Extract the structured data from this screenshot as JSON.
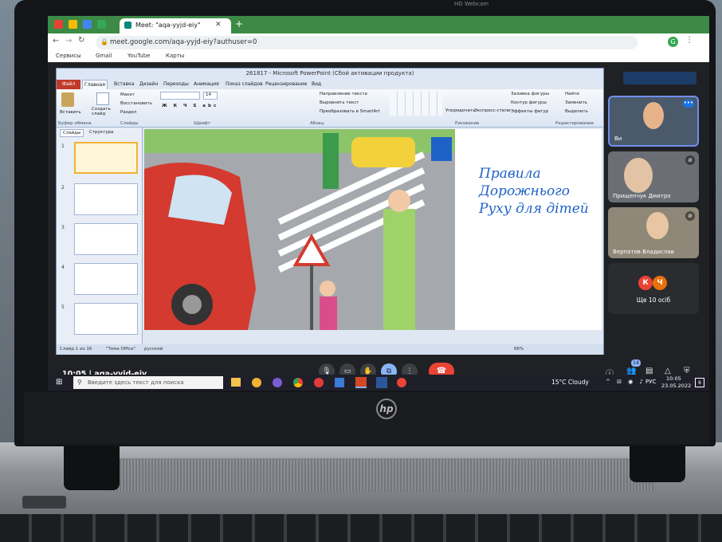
{
  "browser": {
    "tab_title": "Meet: \"aqa-yyjd-eiy\"",
    "close_glyph": "✕",
    "new_tab_glyph": "+",
    "url": "meet.google.com/aqa-yyjd-eiy?authuser=0",
    "bookmarks": [
      "Сервисы",
      "Gmail",
      "YouTube",
      "Карты"
    ],
    "profile_letter": "G"
  },
  "ppt": {
    "window_title": "261817 - Microsoft PowerPoint (Сбой активации продукта)",
    "file_tab": "Файл",
    "tabs": [
      "Главная",
      "Вставка",
      "Дизайн",
      "Переходы",
      "Анимация",
      "Показ слайдов",
      "Рецензирование",
      "Вид"
    ],
    "ribbon": {
      "paste": "Вставить",
      "create_slide": "Создать слайд",
      "layout": "Макет",
      "restore": "Восстановить",
      "section": "Раздел",
      "font_size": "14",
      "text_direction": "Направление текста",
      "align_text": "Выровнять текст",
      "smartart": "Преобразовать в SmartArt",
      "arrange": "Упорядочить",
      "quick_styles": "Экспресс-стили",
      "shape_fill": "Заливка фигуры",
      "shape_outline": "Контур фигуры",
      "shape_effects": "Эффекты фигур",
      "find": "Найти",
      "replace": "Заменить",
      "select": "Выделить",
      "groups": [
        "Буфер обмена",
        "Слайды",
        "Шрифт",
        "Абзац",
        "Рисование",
        "Редактирование"
      ]
    },
    "panel_tabs": [
      "Слайды",
      "Структура"
    ],
    "thumb_numbers": [
      "1",
      "2",
      "3",
      "4",
      "5"
    ],
    "slide_title": "Правила Дорожнього Руху для дітей",
    "status": {
      "slide_of": "Слайд 1 из 16",
      "theme": "\"Тема Office\"",
      "language": "русский",
      "zoom": "66%"
    }
  },
  "participants": [
    {
      "name": "Ви",
      "muted": false
    },
    {
      "name": "Прищепчук Дмитро",
      "muted": true
    },
    {
      "name": "Верпатов Владислав",
      "muted": true
    }
  ],
  "more_people": {
    "avatars": [
      "К",
      "Ч"
    ],
    "label": "Ще 10 осіб"
  },
  "meet_bar": {
    "time_code": "10:05 | aqa-yyjd-eiy",
    "participant_count": "14"
  },
  "taskbar": {
    "search_placeholder": "Введите здесь текст для поиска",
    "weather": "15°C Cloudy",
    "language": "РУС",
    "time": "10:05",
    "date": "23.05.2022",
    "notifications": "6"
  },
  "laptop": {
    "brand": "hp",
    "webcam_label": "HD Webcam"
  },
  "colors": {
    "chrome_tab_bar": "#3c8a45",
    "meet_bg": "#202124",
    "end_call": "#ea4335",
    "slide_title": "#1f62c7",
    "active_tile_border": "#6f8ff0"
  }
}
